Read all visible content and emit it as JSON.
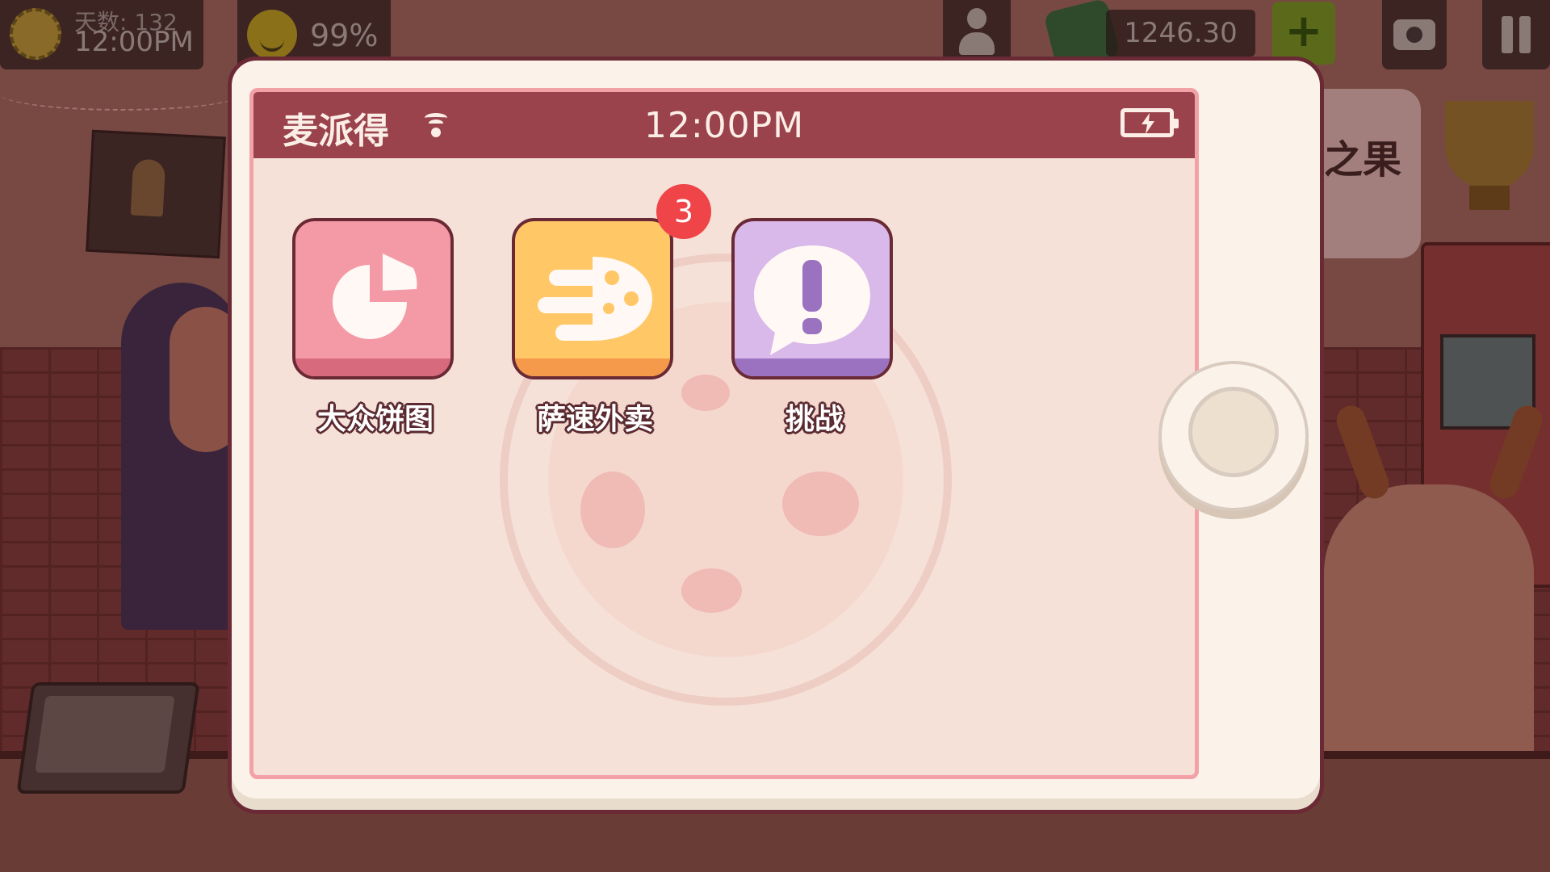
{
  "hud": {
    "days_label": "天数: 132",
    "clock": "12:00PM",
    "mood_value": "99%",
    "money": "1246.30",
    "plus_label": "+"
  },
  "background": {
    "trophy_text": "之果"
  },
  "phone": {
    "carrier": "麦派得",
    "time": "12:00PM",
    "apps": [
      {
        "label": "大众饼图",
        "icon": "pie-chart-icon",
        "color": "#f49aa6"
      },
      {
        "label": "萨速外卖",
        "icon": "fast-pizza-icon",
        "color": "#ffc766",
        "badge": "3"
      },
      {
        "label": "挑战",
        "icon": "exclamation-speech-icon",
        "color": "#d9b8ea"
      }
    ]
  },
  "colors": {
    "status_bar": "#9b434c",
    "screen_bg": "#f6e1d8",
    "phone_frame": "#fbf3ea",
    "badge": "#ef4448"
  }
}
